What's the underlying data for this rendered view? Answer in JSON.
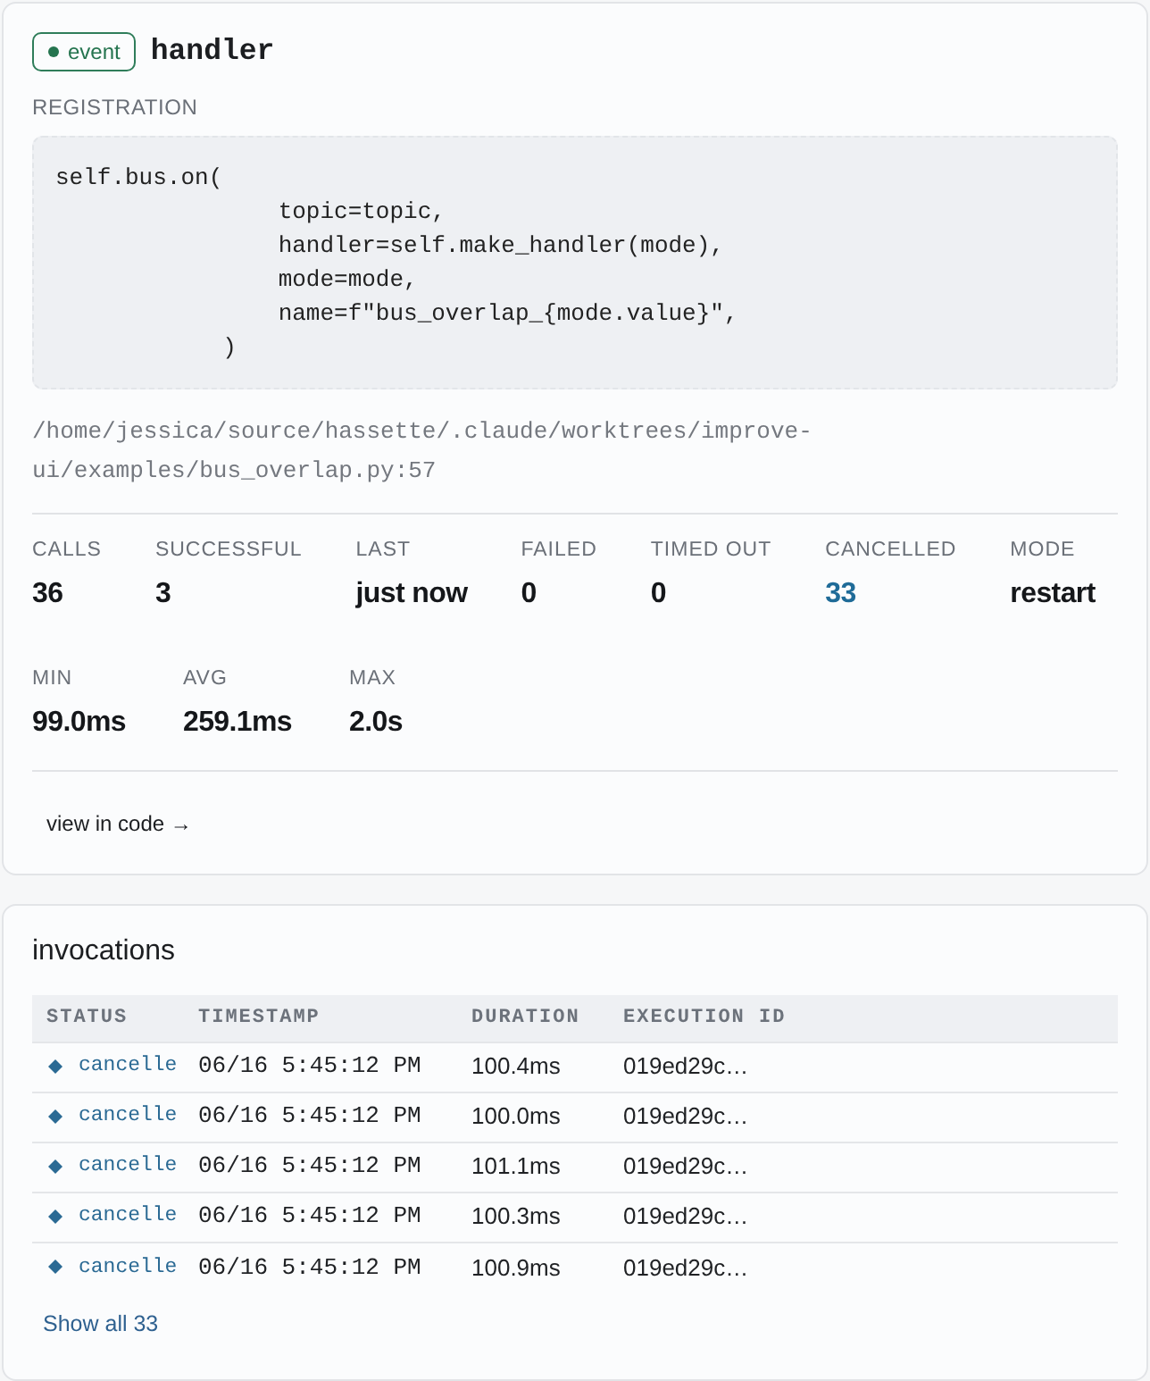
{
  "header": {
    "badge": "event",
    "title": "handler"
  },
  "registration": {
    "label": "REGISTRATION",
    "code": "self.bus.on(\n                topic=topic,\n                handler=self.make_handler(mode),\n                mode=mode,\n                name=f\"bus_overlap_{mode.value}\",\n            )",
    "source_path": "/home/jessica/source/hassette/.claude/worktrees/improve-ui/examples/bus_overlap.py:57"
  },
  "stats": [
    {
      "label": "CALLS",
      "value": "36",
      "kind": "plain"
    },
    {
      "label": "SUCCESSFUL",
      "value": "3",
      "kind": "plain"
    },
    {
      "label": "LAST",
      "value": "just now",
      "kind": "plain"
    },
    {
      "label": "FAILED",
      "value": "0",
      "kind": "plain"
    },
    {
      "label": "TIMED OUT",
      "value": "0",
      "kind": "plain"
    },
    {
      "label": "CANCELLED",
      "value": "33",
      "kind": "link"
    },
    {
      "label": "MODE",
      "value": "restart",
      "kind": "plain"
    }
  ],
  "timing": [
    {
      "label": "MIN",
      "value": "99.0ms"
    },
    {
      "label": "AVG",
      "value": "259.1ms"
    },
    {
      "label": "MAX",
      "value": "2.0s"
    }
  ],
  "view_in_code": "view in code →",
  "invocations": {
    "title": "invocations",
    "columns": [
      "STATUS",
      "TIMESTAMP",
      "DURATION",
      "EXECUTION ID"
    ],
    "rows": [
      {
        "status": "cancelle",
        "timestamp": "06/16 5:45:12 PM",
        "duration": "100.4ms",
        "execution_id": "019ed29c…"
      },
      {
        "status": "cancelle",
        "timestamp": "06/16 5:45:12 PM",
        "duration": "100.0ms",
        "execution_id": "019ed29c…"
      },
      {
        "status": "cancelle",
        "timestamp": "06/16 5:45:12 PM",
        "duration": "101.1ms",
        "execution_id": "019ed29c…"
      },
      {
        "status": "cancelle",
        "timestamp": "06/16 5:45:12 PM",
        "duration": "100.3ms",
        "execution_id": "019ed29c…"
      },
      {
        "status": "cancelle",
        "timestamp": "06/16 5:45:12 PM",
        "duration": "100.9ms",
        "execution_id": "019ed29c…"
      }
    ],
    "show_all": "Show all 33"
  }
}
